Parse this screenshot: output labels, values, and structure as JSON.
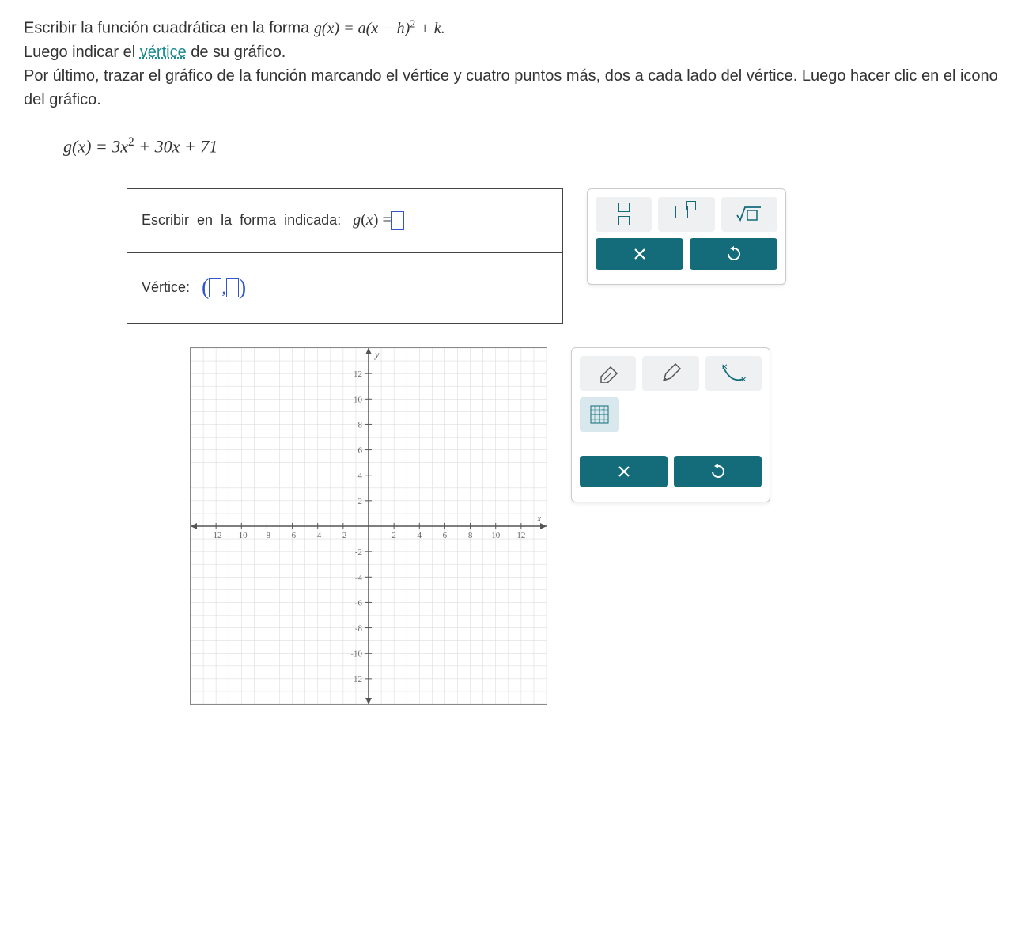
{
  "problem": {
    "line1_a": "Escribir la función cuadrática en la forma ",
    "line1_formula": "g(x) = a(x − h)² + k.",
    "line2_a": "Luego indicar el ",
    "line2_link": "vértice",
    "line2_b": " de su gráfico.",
    "line3": "Por último, trazar el gráfico de la función marcando el vértice y cuatro puntos más, dos a cada lado del vértice. Luego hacer clic en el icono del gráfico."
  },
  "equation": "g(x) = 3x² + 30x + 71",
  "answer": {
    "row1_a": "Escribir",
    "row1_b": "en",
    "row1_c": "la",
    "row1_d": "forma",
    "row1_e": "indicada:",
    "row1_gx": "g(x) =",
    "row2_label": "Vértice:"
  },
  "toolbox1": {
    "tool_fraction": "fraction",
    "tool_exponent": "exponent",
    "tool_sqrt": "sqrt",
    "action_clear": "×",
    "action_reset": "↺"
  },
  "toolbox2": {
    "tool_eraser": "eraser",
    "tool_pencil": "pencil",
    "tool_curve": "curve",
    "tool_grid": "grid",
    "action_clear": "×",
    "action_reset": "↺"
  },
  "chart_data": {
    "type": "cartesian-grid",
    "title": "",
    "xlabel": "x",
    "ylabel": "y",
    "xlim": [
      -14,
      14
    ],
    "ylim": [
      -14,
      14
    ],
    "xticks": [
      -12,
      -10,
      -8,
      -6,
      -4,
      -2,
      2,
      4,
      6,
      8,
      10,
      12
    ],
    "yticks": [
      -12,
      -10,
      -8,
      -6,
      -4,
      -2,
      2,
      4,
      6,
      8,
      10,
      12
    ],
    "grid": true,
    "series": []
  }
}
